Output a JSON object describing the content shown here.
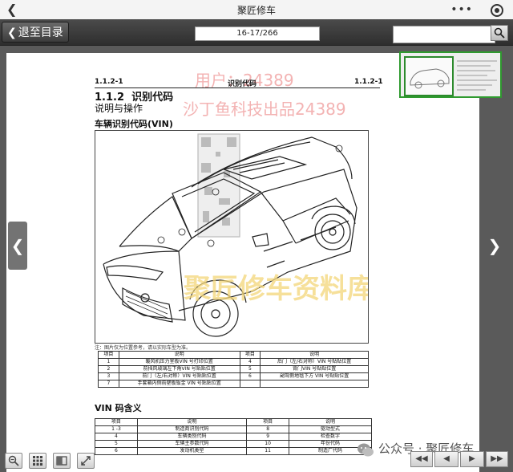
{
  "statusbar": {
    "title": "聚匠修车"
  },
  "toolbar": {
    "exit_label": "退至目录",
    "page_indicator": "16-17/266",
    "search_placeholder": ""
  },
  "page": {
    "section_code_left": "1.1.2-1",
    "section_code_right": "1.1.2-1",
    "header_title": "识别代码",
    "watermark_user": "用户：24389",
    "watermark_brand": "沙丁鱼科技出品24389",
    "watermark_center": "聚匠修车资料库",
    "section_number": "1.1.2",
    "section_title": "识别代码",
    "subsection": "说明与操作",
    "vin_heading": "车辆识别代码(VIN)",
    "figure_note": "注：图片仅为位置参考，请以实际车型为准。",
    "location_table": {
      "headers": [
        "项目",
        "说明",
        "项目",
        "说明"
      ],
      "rows": [
        [
          "1",
          "暖风机压力室板VIN 号打印位置",
          "4",
          "后门（左/右对称）VIN 号贴贴位置"
        ],
        [
          "2",
          "前挡风玻璃左下角VIN 号贴贴位置",
          "5",
          "背门VIN 号贴贴位置"
        ],
        [
          "3",
          "前门（左/右对称）VIN 号贴贴位置",
          "6",
          "副驾侧地毯下方 VIN 号贴贴位置"
        ],
        [
          "7",
          "手套箱内侧前壁板钣金 VIN 号贴贴位置",
          "",
          ""
        ]
      ]
    },
    "vin_meaning_title": "VIN 码含义",
    "vin_table": {
      "headers": [
        "项目",
        "说明",
        "项目",
        "说明"
      ],
      "rows": [
        [
          "1 -3",
          "制造商识别代码",
          "8",
          "驱动型式"
        ],
        [
          "4",
          "车辆类别代码",
          "9",
          "检查数字"
        ],
        [
          "5",
          "车辆主参数代码",
          "10",
          "年份代码"
        ],
        [
          "6",
          "发动机类型",
          "11",
          "制造厂代码"
        ]
      ]
    }
  },
  "watermark": {
    "wechat": "公众号 · 聚匠修车"
  },
  "icons": [
    "back-icon",
    "more-icon",
    "target-icon",
    "search-icon",
    "zoom-out-icon",
    "grid-icon",
    "book-icon",
    "fullscreen-icon",
    "prev-arrow-icon",
    "next-arrow-icon",
    "first-page-icon",
    "prev-page-icon",
    "next-page-icon",
    "last-page-icon"
  ],
  "colors": {
    "toolbar": "#3c3c3c",
    "thumb_border": "#2f9a2f",
    "watermark_red": "#f3b3b3",
    "watermark_gold": "#f3d679"
  }
}
